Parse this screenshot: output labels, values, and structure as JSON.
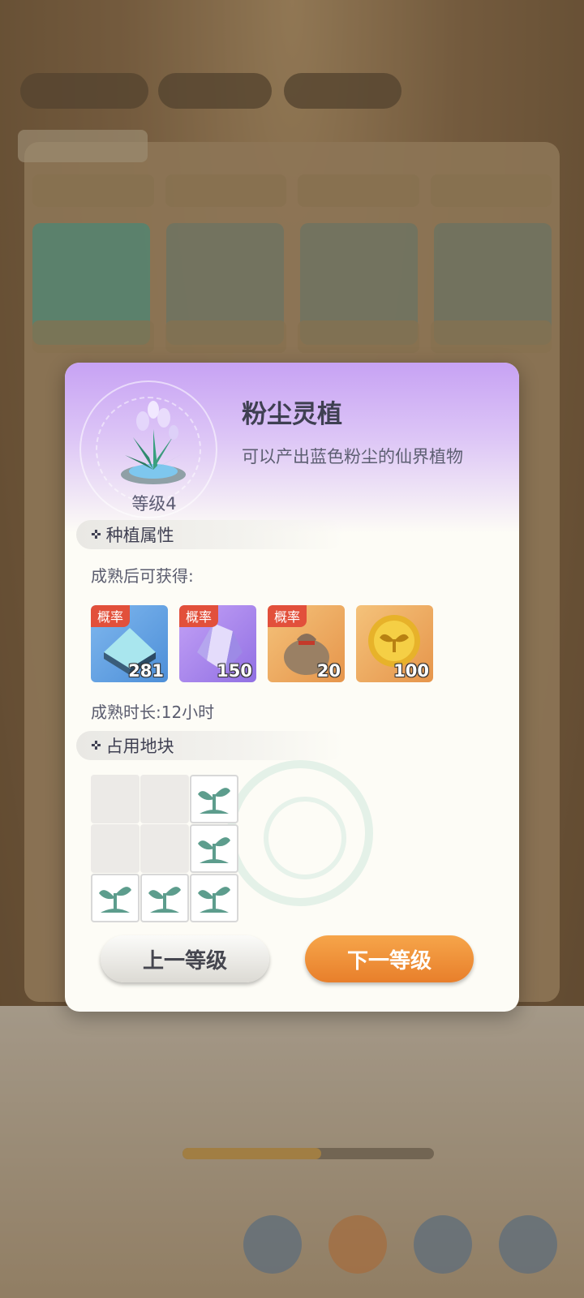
{
  "plant": {
    "name": "粉尘灵植",
    "description": "可以产出蓝色粉尘的仙界植物",
    "level": "等级4",
    "icon": "crystal-flower-icon"
  },
  "attributes": {
    "section_title": "种植属性",
    "harvest_label": "成熟后可获得:",
    "maturity_time": "成熟时长:12小时",
    "rewards": [
      {
        "tag": "概率",
        "quantity": "281",
        "icon": "blue-ore-block-icon"
      },
      {
        "tag": "概率",
        "quantity": "150",
        "icon": "purple-crystal-icon"
      },
      {
        "tag": "概率",
        "quantity": "20",
        "icon": "seed-bag-icon"
      },
      {
        "tag": "",
        "quantity": "100",
        "icon": "gold-sprout-coin-icon"
      }
    ]
  },
  "plot": {
    "section_title": "占用地块",
    "cells": [
      false,
      false,
      true,
      false,
      false,
      true,
      true,
      true,
      true
    ]
  },
  "buttons": {
    "prev": "上一等级",
    "next": "下一等级"
  },
  "colors": {
    "header_purple": "#c7a2f4",
    "next_button": "#e87f2b",
    "tag_red": "#e2503b"
  }
}
